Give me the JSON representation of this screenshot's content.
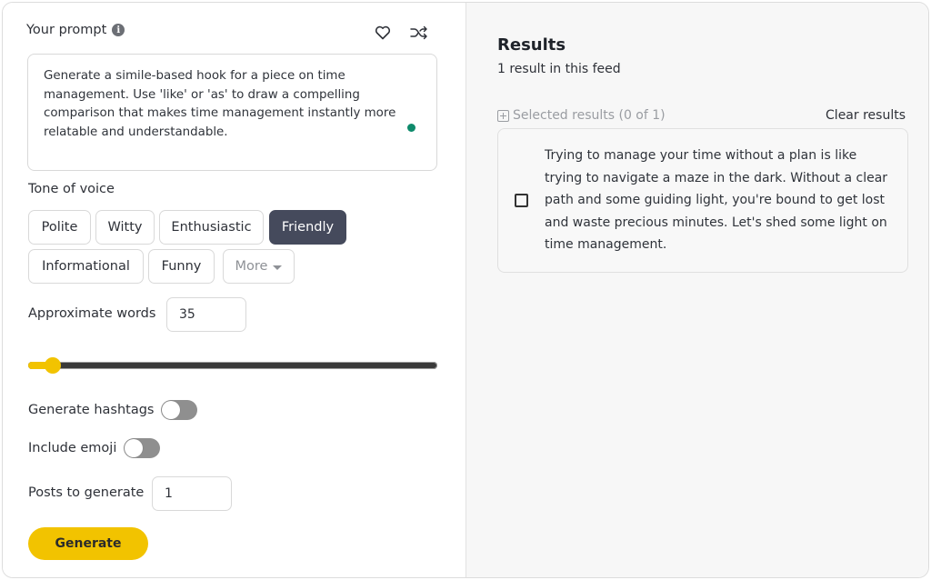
{
  "prompt": {
    "label": "Your prompt",
    "info_icon": "info-icon",
    "favorite_icon": "heart-icon",
    "shuffle_icon": "shuffle-icon",
    "text": "Generate a simile-based hook for a piece on time management. Use 'like' or 'as' to draw a compelling comparison that makes time management instantly more relatable and understandable.",
    "status_color": "#0e8a6b"
  },
  "tone": {
    "label": "Tone of voice",
    "options": [
      {
        "label": "Polite",
        "selected": false
      },
      {
        "label": "Witty",
        "selected": false
      },
      {
        "label": "Enthusiastic",
        "selected": false
      },
      {
        "label": "Friendly",
        "selected": true
      },
      {
        "label": "Informational",
        "selected": false
      },
      {
        "label": "Funny",
        "selected": false
      }
    ],
    "more_label": "More",
    "selected_color": "#454a5c"
  },
  "words": {
    "label": "Approximate words",
    "value": "35",
    "slider_fraction": 0.06
  },
  "toggles": {
    "hashtags": {
      "label": "Generate hashtags",
      "on": false
    },
    "emoji": {
      "label": "Include emoji",
      "on": false
    }
  },
  "posts": {
    "label": "Posts to generate",
    "value": "1"
  },
  "generate": {
    "label": "Generate",
    "color": "#f2c300"
  },
  "results": {
    "title": "Results",
    "count_text": "1 result in this feed",
    "selected_text": "Selected results (0 of 1)",
    "clear_label": "Clear results",
    "items": [
      {
        "checked": false,
        "text": "Trying to manage your time without a plan is like trying to navigate a maze in the dark. Without a clear path and some guiding light, you're bound to get lost and waste precious minutes. Let's shed some light on time management."
      }
    ]
  }
}
